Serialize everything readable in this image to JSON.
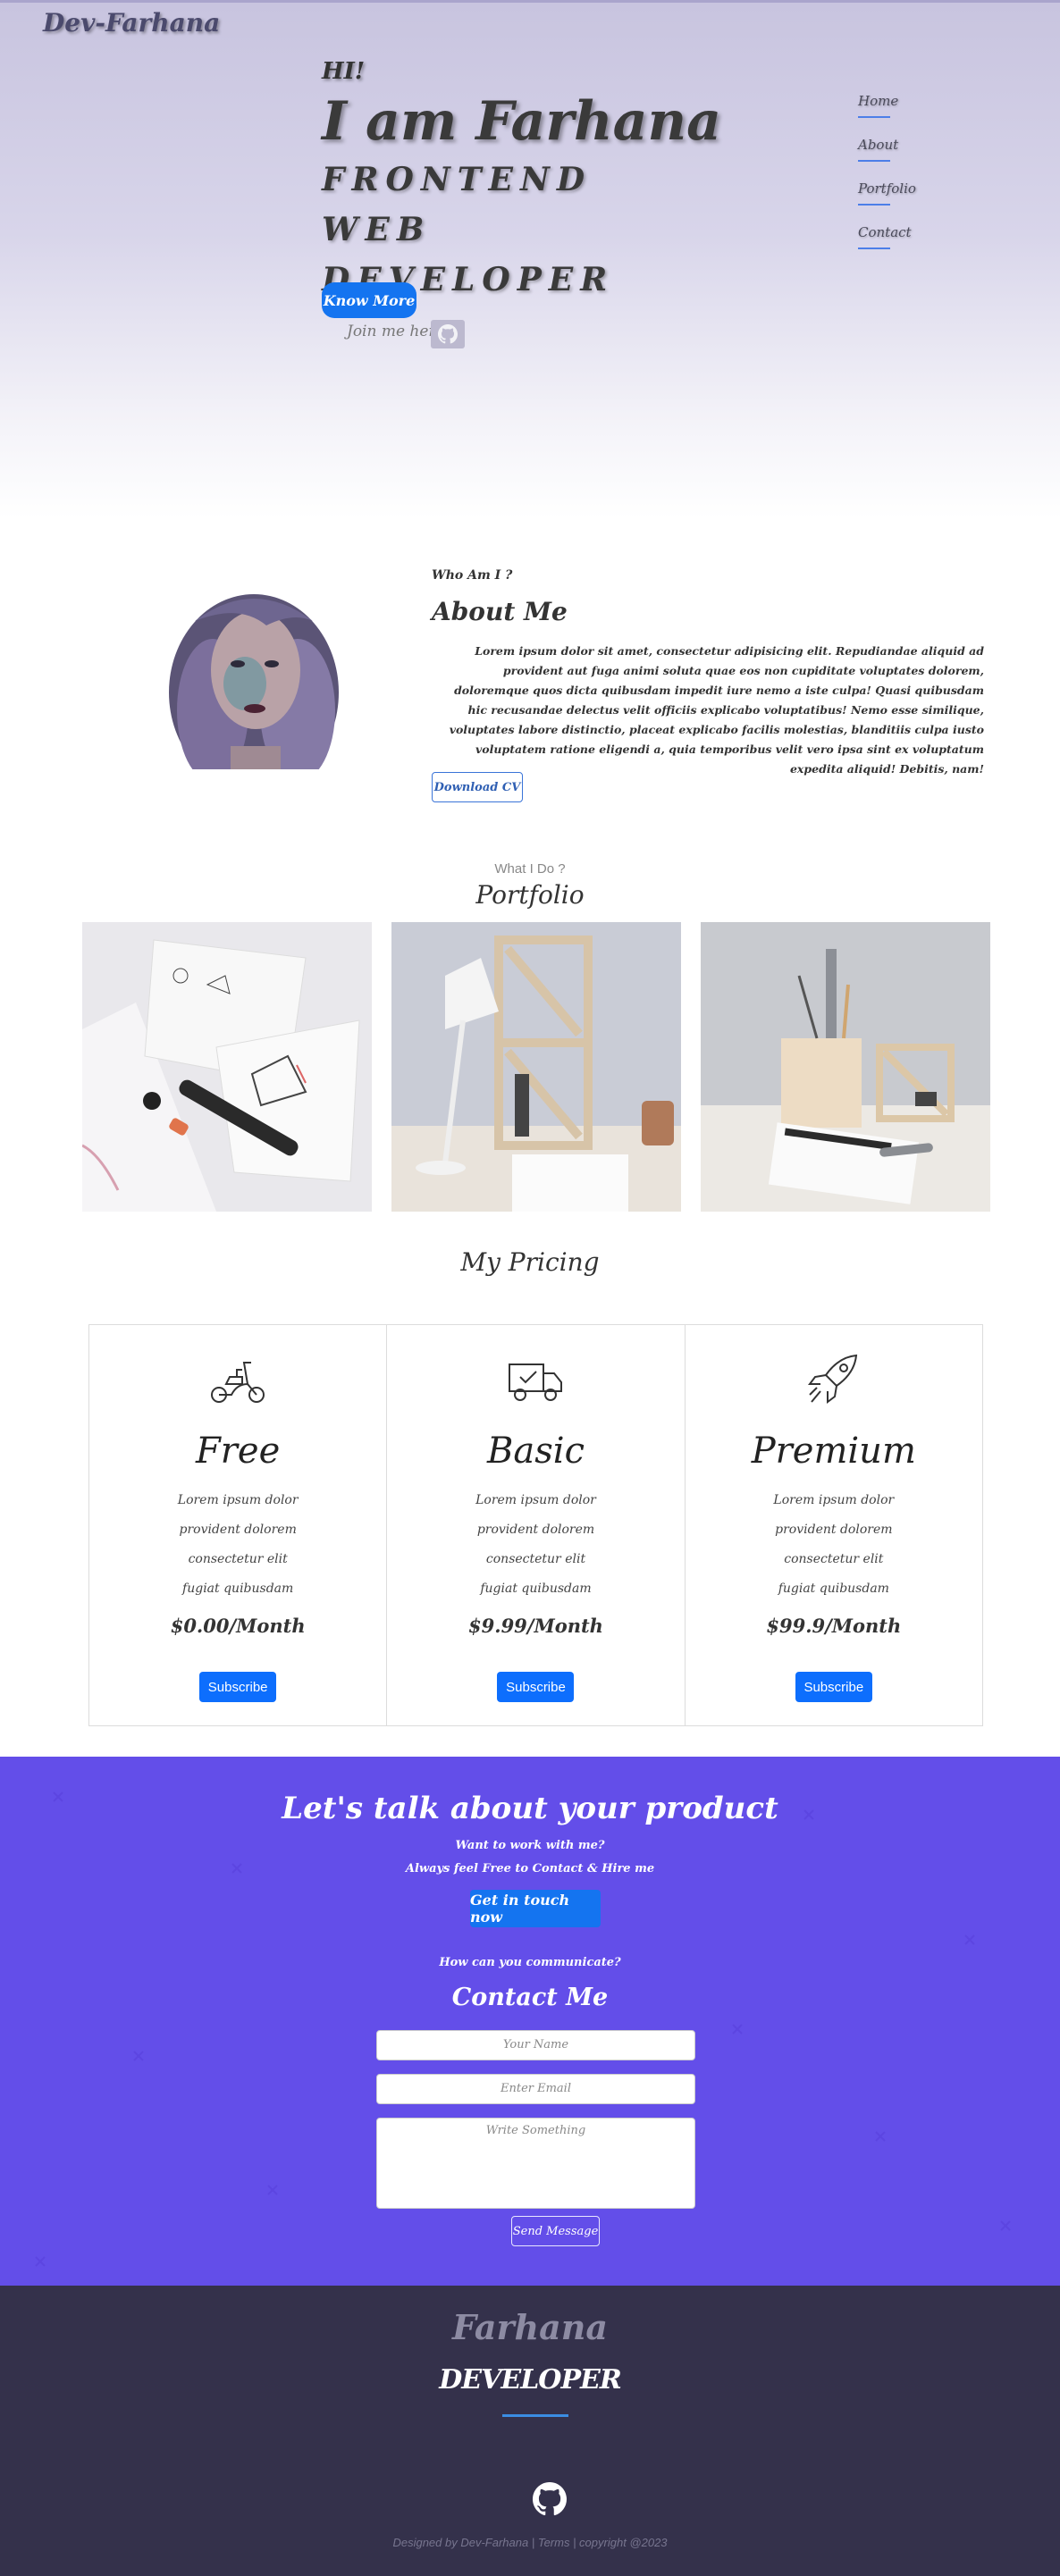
{
  "header": {
    "brand": "Dev-Farhana"
  },
  "hero": {
    "greeting": "HI!",
    "name": "I am Farhana",
    "role": "FRONTEND WEB DEVELOPER",
    "cta_label": "Know More",
    "join_text": "Join me here"
  },
  "nav": {
    "items": [
      "Home",
      "About",
      "Portfolio",
      "Contact"
    ]
  },
  "about": {
    "kicker": "Who Am I ?",
    "title": "About Me",
    "text": "Lorem ipsum dolor sit amet, consectetur adipisicing elit. Repudiandae aliquid ad provident aut fuga animi soluta quae eos non cupiditate voluptates dolorem, doloremque quos dicta quibusdam impedit iure nemo a iste culpa! Quasi quibusdam hic recusandae delectus velit officiis explicabo voluptatibus! Nemo esse similique, voluptates labore distinctio, placeat explicabo facilis molestias, blanditiis culpa iusto voluptatem ratione eligendi a, quia temporibus velit vero ipsa sint ex voluptatum expedita aliquid! Debitis, nam!",
    "button": "Download CV"
  },
  "portfolio": {
    "kicker": "What I Do ?",
    "title": "Portfolio"
  },
  "pricing": {
    "title": "My Pricing",
    "plans": [
      {
        "name": "Free",
        "icon": "scooter-icon",
        "desc": [
          "Lorem ipsum dolor",
          "provident dolorem",
          "consectetur elit",
          "fugiat quibusdam"
        ],
        "price": "$0.00/Month",
        "button": "Subscribe"
      },
      {
        "name": "Basic",
        "icon": "truck-icon",
        "desc": [
          "Lorem ipsum dolor",
          "provident dolorem",
          "consectetur elit",
          "fugiat quibusdam"
        ],
        "price": "$9.99/Month",
        "button": "Subscribe"
      },
      {
        "name": "Premium",
        "icon": "rocket-icon",
        "desc": [
          "Lorem ipsum dolor",
          "provident dolorem",
          "consectetur elit",
          "fugiat quibusdam"
        ],
        "price": "$99.9/Month",
        "button": "Subscribe"
      }
    ]
  },
  "contact": {
    "title": "Let's talk about your product",
    "line1": "Want to work with me?",
    "line2": "Always feel Free to Contact & Hire me",
    "cta": "Get in touch now",
    "sub": "How can you communicate?",
    "heading": "Contact Me",
    "name_placeholder": "Your Name",
    "email_placeholder": "Enter Email",
    "message_placeholder": "Write Something",
    "send": "Send Message"
  },
  "footer": {
    "name": "Farhana",
    "role": "DEVELOPER",
    "copyright": "Designed by Dev-Farhana | Terms | copyright @2023"
  },
  "colors": {
    "accent": "#1474f0",
    "contact_bg": "#634ee9",
    "footer_bg": "#34314b"
  }
}
